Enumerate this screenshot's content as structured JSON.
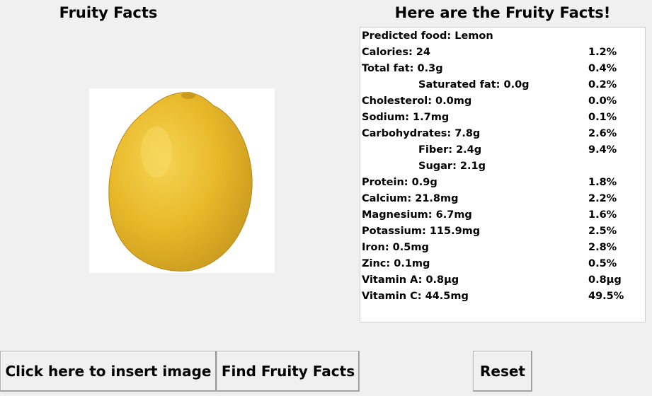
{
  "left_title": "Fruity Facts",
  "right_title": "Here are the Fruity Facts!",
  "image": {
    "subject": "lemon",
    "colors": {
      "lemon": "#e8b82a",
      "lemon_shadow": "#c99a1e",
      "lemon_highlight": "#f6d453",
      "background": "#ffffff"
    }
  },
  "facts": [
    {
      "label": "Predicted food: Lemon",
      "pct": "",
      "indent": false
    },
    {
      "label": "Calories: 24",
      "pct": "1.2%",
      "indent": false
    },
    {
      "label": "Total fat: 0.3g",
      "pct": "0.4%",
      "indent": false
    },
    {
      "label": "Saturated fat: 0.0g",
      "pct": "0.2%",
      "indent": true
    },
    {
      "label": "Cholesterol: 0.0mg",
      "pct": "0.0%",
      "indent": false
    },
    {
      "label": "Sodium: 1.7mg",
      "pct": "0.1%",
      "indent": false
    },
    {
      "label": "Carbohydrates: 7.8g",
      "pct": "2.6%",
      "indent": false
    },
    {
      "label": "Fiber: 2.4g",
      "pct": "9.4%",
      "indent": true
    },
    {
      "label": "Sugar: 2.1g",
      "pct": "",
      "indent": true
    },
    {
      "label": "Protein: 0.9g",
      "pct": "1.8%",
      "indent": false
    },
    {
      "label": "Calcium: 21.8mg",
      "pct": "2.2%",
      "indent": false
    },
    {
      "label": "Magnesium: 6.7mg",
      "pct": "1.6%",
      "indent": false
    },
    {
      "label": "Potassium: 115.9mg",
      "pct": "2.5%",
      "indent": false
    },
    {
      "label": "Iron: 0.5mg",
      "pct": "2.8%",
      "indent": false
    },
    {
      "label": "Zinc: 0.1mg",
      "pct": "0.5%",
      "indent": false
    },
    {
      "label": "Vitamin A: 0.8µg",
      "pct": "0.8µg",
      "indent": false
    },
    {
      "label": "Vitamin C: 44.5mg",
      "pct": "49.5%",
      "indent": false
    }
  ],
  "buttons": {
    "insert_label": "Click here to insert image",
    "find_label": "Find Fruity Facts",
    "reset_label": "Reset"
  }
}
